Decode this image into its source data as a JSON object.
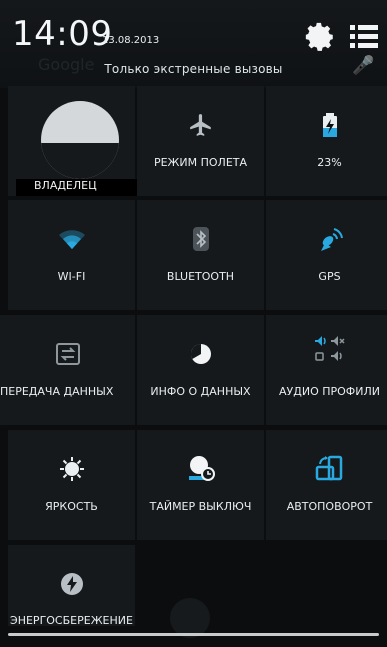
{
  "status_bar": {
    "time": "14:09",
    "date": "13.08.2013",
    "emergency_text": "Только экстренные вызовы",
    "background_search_text": "Google"
  },
  "tiles": [
    {
      "label": "ВЛАДЕЛЕЦ",
      "icon": "owner-avatar-icon"
    },
    {
      "label": "РЕЖИМ ПОЛЕТА",
      "icon": "airplane-icon"
    },
    {
      "label": "23%",
      "icon": "battery-icon"
    },
    {
      "label": "WI-FI",
      "icon": "wifi-icon"
    },
    {
      "label": "BLUETOOTH",
      "icon": "bluetooth-icon"
    },
    {
      "label": "GPS",
      "icon": "gps-icon"
    },
    {
      "label": "ПЕРЕДАЧА ДАННЫХ",
      "icon": "data-transfer-icon"
    },
    {
      "label": "ИНФО О ДАННЫХ",
      "icon": "data-usage-icon"
    },
    {
      "label": "АУДИО ПРОФИЛИ",
      "icon": "audio-profiles-icon"
    },
    {
      "label": "ЯРКОСТЬ",
      "icon": "brightness-icon"
    },
    {
      "label": "ТАЙМЕР ВЫКЛЮЧ",
      "icon": "sleep-timer-icon"
    },
    {
      "label": "АВТОПОВОРОТ",
      "icon": "auto-rotate-icon"
    },
    {
      "label": "ЭНЕРГОСБЕРЕЖЕНИЕ",
      "icon": "power-saving-icon"
    }
  ],
  "colors": {
    "accent_blue": "#2aa9e0",
    "tile_bg": "#15191c",
    "background": "#0b0d0f",
    "icon_gray": "#b9c0c5"
  }
}
